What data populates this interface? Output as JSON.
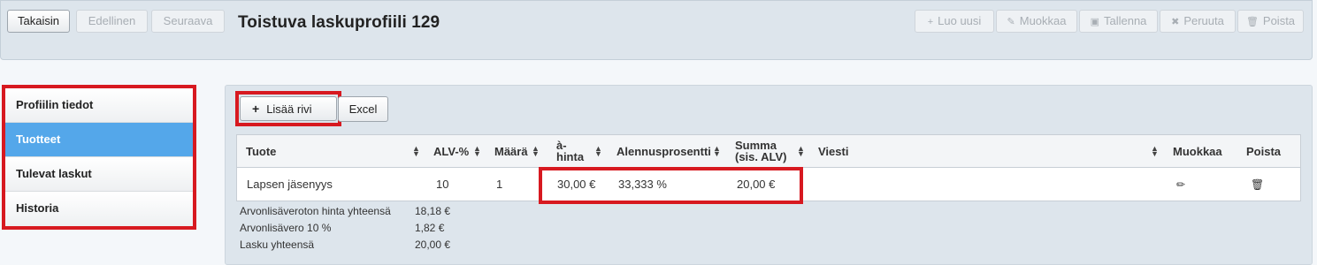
{
  "toolbar": {
    "back": "Takaisin",
    "previous": "Edellinen",
    "next": "Seuraava",
    "title": "Toistuva laskuprofiili 129",
    "new": "Luo uusi",
    "edit": "Muokkaa",
    "save": "Tallenna",
    "cancel": "Peruuta",
    "delete": "Poista"
  },
  "sidebar": {
    "items": [
      {
        "label": "Profiilin tiedot",
        "active": false
      },
      {
        "label": "Tuotteet",
        "active": true
      },
      {
        "label": "Tulevat laskut",
        "active": false
      },
      {
        "label": "Historia",
        "active": false
      }
    ]
  },
  "actions": {
    "add_row": "Lisää rivi",
    "excel": "Excel"
  },
  "table": {
    "headers": {
      "product": "Tuote",
      "vat": "ALV-%",
      "quantity": "Määrä",
      "unit_price_1": "à-",
      "unit_price_2": "hinta",
      "discount": "Alennusprosentti",
      "sum_1": "Summa",
      "sum_2": "(sis. ALV)",
      "message": "Viesti",
      "edit": "Muokkaa",
      "delete": "Poista"
    },
    "rows": [
      {
        "product": "Lapsen jäsenyys",
        "vat": "10",
        "quantity": "1",
        "unit_price": "30,00 €",
        "discount": "33,333 %",
        "sum": "20,00 €",
        "message": ""
      }
    ]
  },
  "totals": [
    {
      "label": "Arvonlisäveroton hinta yhteensä",
      "value": "18,18 €"
    },
    {
      "label": "Arvonlisävero 10 %",
      "value": "1,82 €"
    },
    {
      "label": "Lasku yhteensä",
      "value": "20,00 €"
    }
  ],
  "colors": {
    "accent": "#54a7ea",
    "highlight": "#d71920",
    "panel": "#dde5ec"
  }
}
